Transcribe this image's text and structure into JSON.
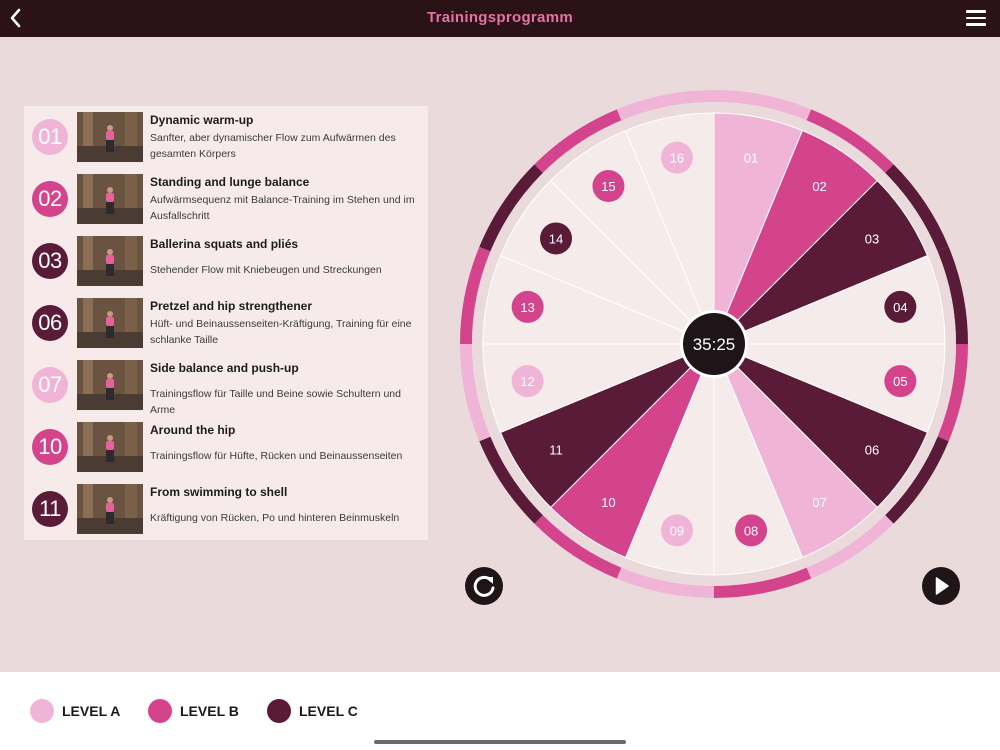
{
  "header": {
    "title": "Trainingsprogramm"
  },
  "colors": {
    "level_a": "#f0b5d6",
    "level_b": "#d4448d",
    "level_c": "#5a1b38",
    "bg": "#eadadc",
    "light_segment": "#f6ebeb"
  },
  "exercises": [
    {
      "num": "01",
      "level": "a",
      "title": "Dynamic warm-up",
      "desc": "Sanfter, aber dynamischer Flow zum Aufwärmen des gesamten Körpers"
    },
    {
      "num": "02",
      "level": "b",
      "title": "Standing and lunge balance",
      "desc": "Aufwärmsequenz mit Balance-Training im Stehen und im Ausfallschritt"
    },
    {
      "num": "03",
      "level": "c",
      "title": "Ballerina squats and pliés",
      "desc": "Stehender Flow mit Kniebeugen und Streckungen"
    },
    {
      "num": "06",
      "level": "c",
      "title": "Pretzel and hip strengthener",
      "desc": "Hüft- und Beinaussenseiten-Kräftigung, Training für eine schlanke Taille"
    },
    {
      "num": "07",
      "level": "a",
      "title": "Side balance and push-up",
      "desc": "Trainingsflow für Taille und Beine sowie Schultern und Arme"
    },
    {
      "num": "10",
      "level": "b",
      "title": "Around the hip",
      "desc": "Trainingsflow für Hüfte, Rücken und Beinaussenseiten"
    },
    {
      "num": "11",
      "level": "c",
      "title": "From swimming to shell",
      "desc": "Kräftigung von Rücken, Po und hinteren Beinmuskeln"
    }
  ],
  "wheel": {
    "timer": "35:25",
    "segments": [
      {
        "num": "01",
        "level": "a",
        "selected": true
      },
      {
        "num": "02",
        "level": "b",
        "selected": true
      },
      {
        "num": "03",
        "level": "c",
        "selected": true
      },
      {
        "num": "04",
        "level": "c",
        "selected": false
      },
      {
        "num": "05",
        "level": "b",
        "selected": false
      },
      {
        "num": "06",
        "level": "c",
        "selected": true
      },
      {
        "num": "07",
        "level": "a",
        "selected": true
      },
      {
        "num": "08",
        "level": "b",
        "selected": false
      },
      {
        "num": "09",
        "level": "a",
        "selected": false
      },
      {
        "num": "10",
        "level": "b",
        "selected": true
      },
      {
        "num": "11",
        "level": "c",
        "selected": true
      },
      {
        "num": "12",
        "level": "a",
        "selected": false
      },
      {
        "num": "13",
        "level": "b",
        "selected": false
      },
      {
        "num": "14",
        "level": "c",
        "selected": false
      },
      {
        "num": "15",
        "level": "b",
        "selected": false
      },
      {
        "num": "16",
        "level": "a",
        "selected": false
      }
    ]
  },
  "legend": [
    {
      "level": "a",
      "label": "LEVEL A"
    },
    {
      "level": "b",
      "label": "LEVEL B"
    },
    {
      "level": "c",
      "label": "LEVEL C"
    }
  ],
  "icons": {
    "back": "chevron-left-icon",
    "menu": "hamburger-menu-icon",
    "reset": "refresh-icon",
    "play": "play-icon"
  }
}
